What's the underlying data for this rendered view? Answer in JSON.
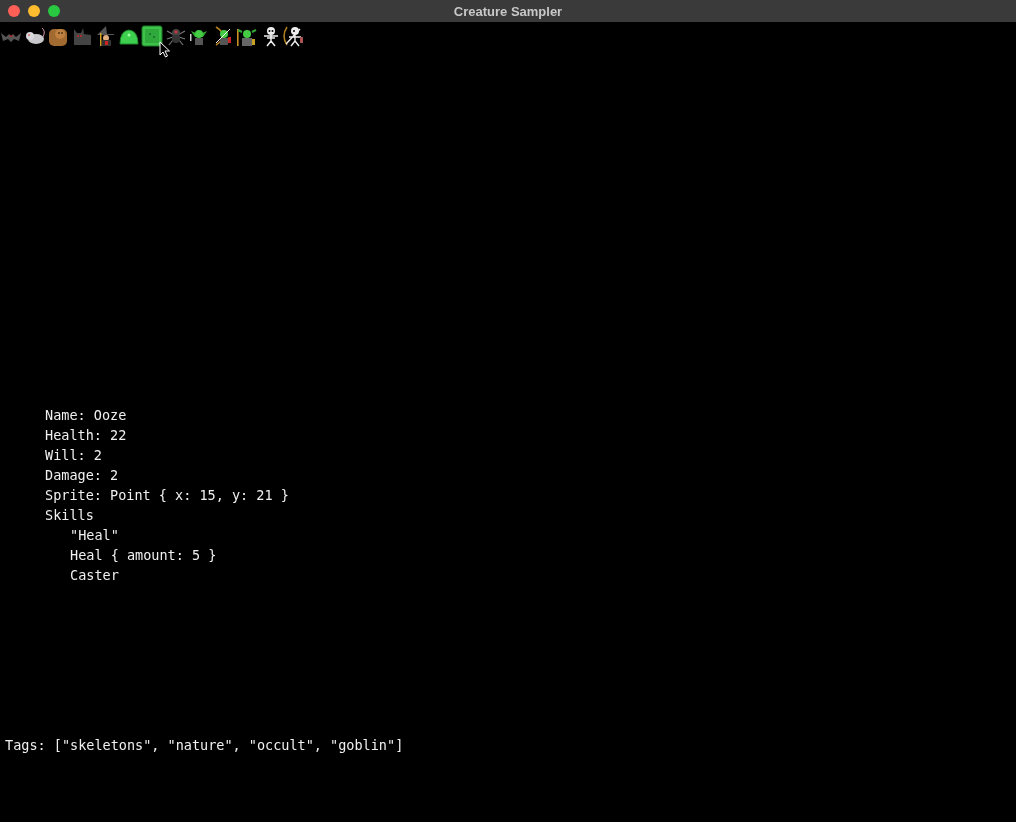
{
  "window": {
    "title": "Creature Sampler"
  },
  "sprites": [
    {
      "kind": "bat",
      "hovered": false
    },
    {
      "kind": "rat",
      "hovered": false
    },
    {
      "kind": "bear",
      "hovered": false
    },
    {
      "kind": "wolf",
      "hovered": false
    },
    {
      "kind": "witch",
      "hovered": false
    },
    {
      "kind": "slime",
      "hovered": false
    },
    {
      "kind": "cube",
      "hovered": true
    },
    {
      "kind": "spider",
      "hovered": false
    },
    {
      "kind": "goblin",
      "hovered": false
    },
    {
      "kind": "goblin_archer",
      "hovered": false
    },
    {
      "kind": "goblin_shaman",
      "hovered": false
    },
    {
      "kind": "skeleton",
      "hovered": false
    },
    {
      "kind": "skeleton_archer",
      "hovered": false
    }
  ],
  "details": {
    "lines": [
      "Name: Ooze",
      "Health: 22",
      "Will: 2",
      "Damage: 2",
      "Sprite: Point { x: 15, y: 21 }"
    ],
    "skills_label": "Skills",
    "skills": [
      "\"Heal\"",
      "Heal { amount: 5 }",
      "Caster"
    ]
  },
  "tags": "Tags: [\"skeletons\", \"nature\", \"occult\", \"goblin\"]"
}
